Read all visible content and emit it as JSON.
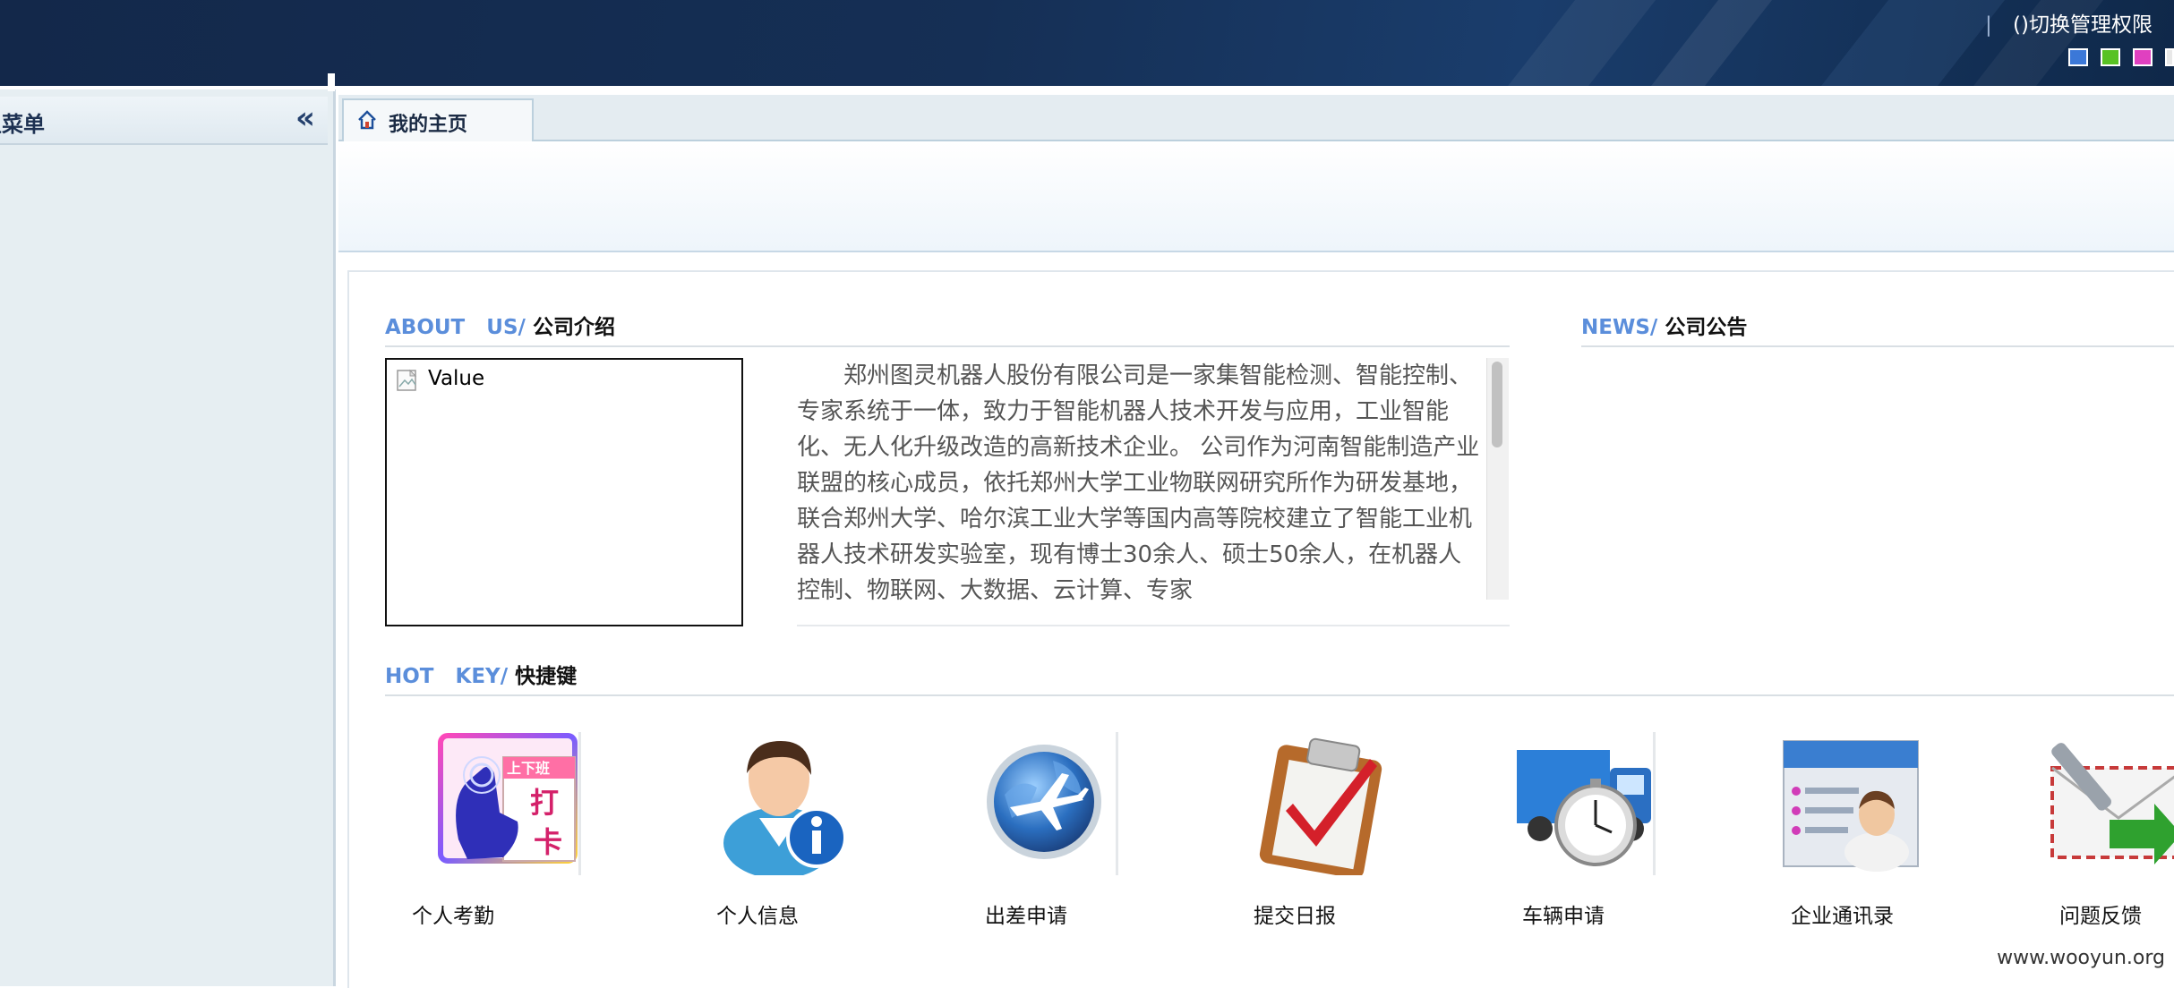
{
  "header": {
    "separator": "|",
    "switch_permission_label": "()切换管理权限",
    "theme_colors": [
      "#3b78d8",
      "#58c224",
      "#e040c0",
      "#e8e8e8"
    ]
  },
  "sidebar": {
    "title": "主菜单",
    "collapse_glyph": "«"
  },
  "tabs": [
    {
      "label": "我的主页"
    }
  ],
  "about": {
    "en_label": "ABOUT   US/",
    "zh_label": "公司介绍",
    "image_alt": "Value",
    "text": "郑州图灵机器人股份有限公司是一家集智能检测、智能控制、专家系统于一体，致力于智能机器人技术开发与应用，工业智能化、无人化升级改造的高新技术企业。 公司作为河南智能制造产业联盟的核心成员，依托郑州大学工业物联网研究所作为研发基地，联合郑州大学、哈尔滨工业大学等国内高等院校建立了智能工业机器人技术研发实验室，现有博士30余人、硕士50余人，在机器人控制、物联网、大数据、云计算、专家"
  },
  "news": {
    "en_label": "NEWS/",
    "zh_label": "公司公告"
  },
  "hotkeys": {
    "en_label": "HOT   KEY/",
    "zh_label": "快捷键",
    "items": [
      {
        "label": "个人考勤",
        "icon": "attendance-punch-icon",
        "icon_text_top": "上下班",
        "icon_text_a": "打",
        "icon_text_b": "卡"
      },
      {
        "label": "个人信息",
        "icon": "user-info-icon"
      },
      {
        "label": "出差申请",
        "icon": "globe-airplane-icon"
      },
      {
        "label": "提交日报",
        "icon": "clipboard-check-icon"
      },
      {
        "label": "车辆申请",
        "icon": "truck-stopwatch-icon"
      },
      {
        "label": "企业通讯录",
        "icon": "contact-card-icon"
      },
      {
        "label": "问题反馈",
        "icon": "mail-feedback-icon"
      }
    ]
  },
  "footer": {
    "watermark": "www.wooyun.org"
  }
}
